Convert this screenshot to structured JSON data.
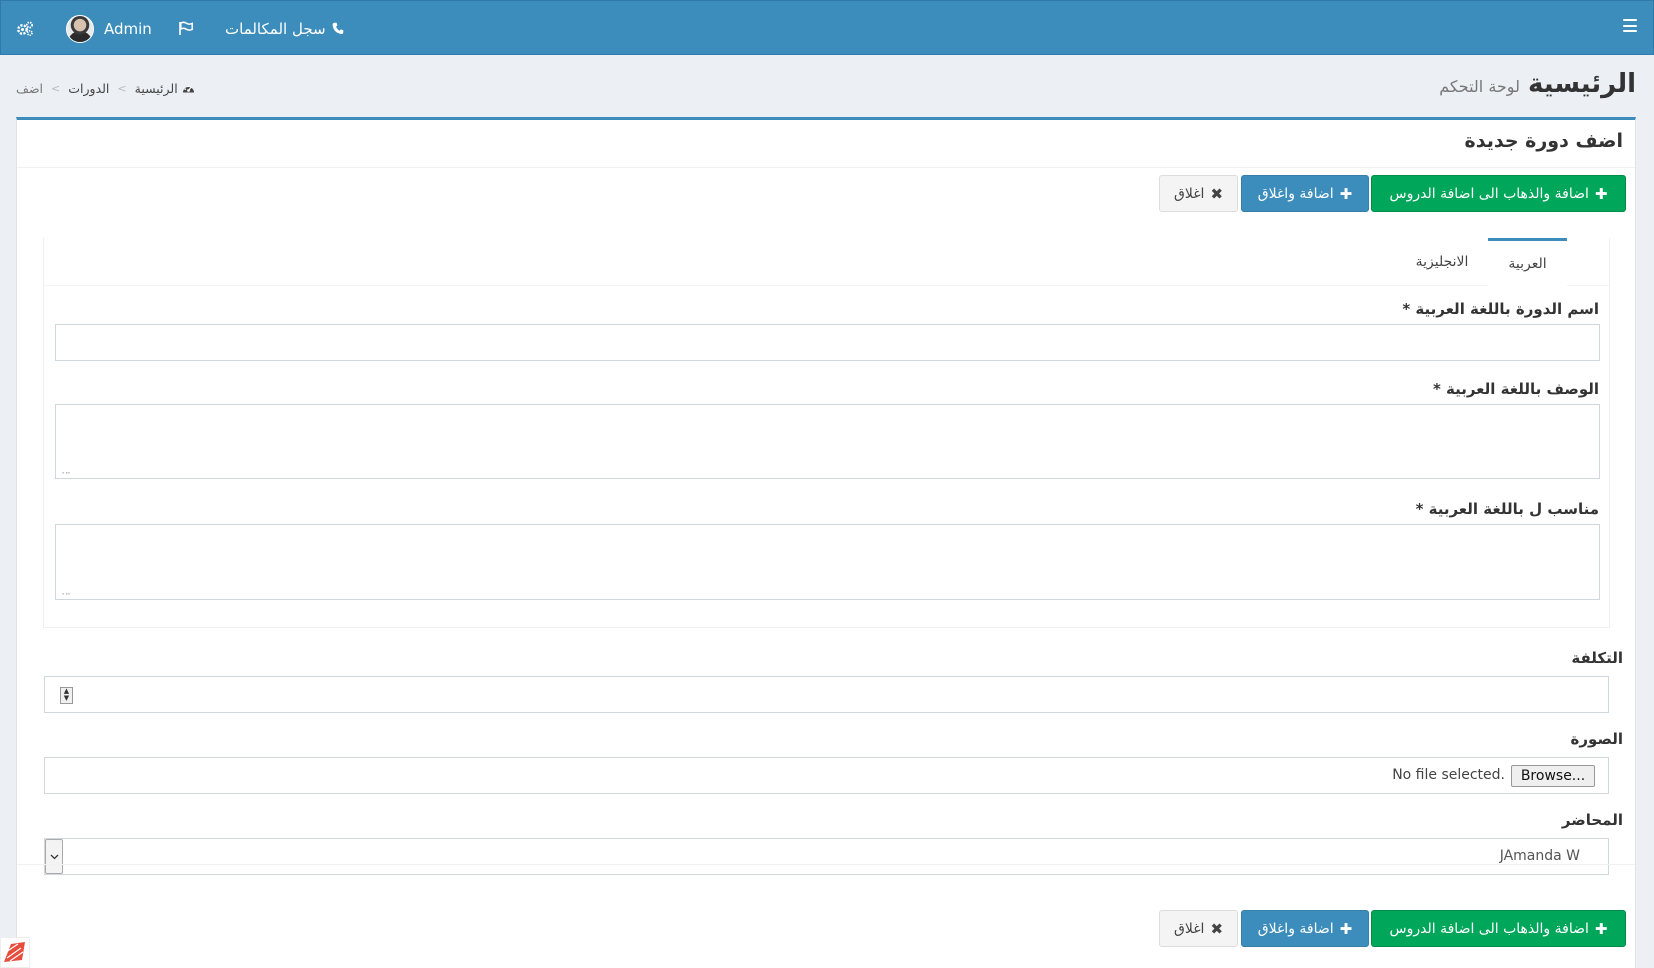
{
  "topbar": {
    "calls_label": "سجل المكالمات",
    "user_name": "Admin"
  },
  "header": {
    "title": "الرئيسية",
    "subtitle": "لوحة التحكم"
  },
  "breadcrumb": {
    "home": "الرئيسية",
    "courses": "الدورات",
    "current": "اضف"
  },
  "box": {
    "title": "اضف دورة جديدة"
  },
  "buttons": {
    "add_and_go": "اضافة والذهاب الى اضافة الدروس",
    "add_and_close": "اضافة واغلاق",
    "close": "اغلاق"
  },
  "tabs": [
    {
      "label": "العربية",
      "active": true
    },
    {
      "label": "الانجليزية",
      "active": false
    }
  ],
  "form": {
    "name_label": "اسم الدورة باللغة العربية *",
    "name_value": "",
    "description_label": "الوصف باللغة العربية *",
    "description_value": "",
    "suitable_label": "مناسب ل باللغة العربية *",
    "suitable_value": "",
    "cost_label": "التكلفة",
    "cost_value": "",
    "image_label": "الصورة",
    "browse_label": "Browse...",
    "no_file": "No file selected.",
    "instructor_label": "المحاضر",
    "instructor_value": "JAmanda W"
  },
  "colors": {
    "topbar": "#3c8dbc",
    "success": "#00a65a",
    "primary": "#3c8dbc",
    "background": "#ecf0f5"
  },
  "icons": [
    "hamburger-icon",
    "phone-icon",
    "flag-icon",
    "gears-icon",
    "dashboard-icon",
    "plus-icon",
    "times-icon"
  ]
}
